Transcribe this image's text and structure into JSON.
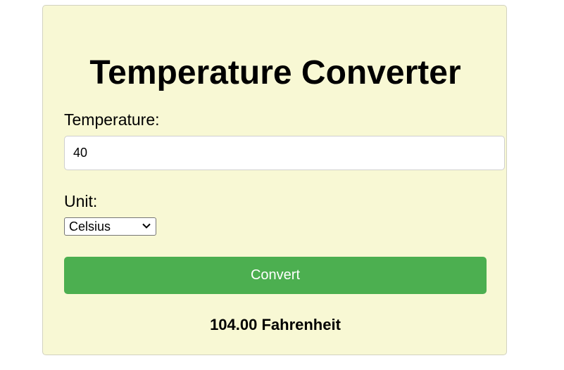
{
  "header": {
    "title": "Temperature Converter"
  },
  "form": {
    "temperature_label": "Temperature:",
    "temperature_value": "40",
    "unit_label": "Unit:",
    "unit_selected": "Celsius",
    "convert_label": "Convert"
  },
  "result": {
    "text": "104.00 Fahrenheit"
  },
  "colors": {
    "card_background": "#f8f8d4",
    "button": "#4caf50",
    "button_text": "#ffffff"
  },
  "icons": {
    "select_arrow": "chevron-down-icon"
  }
}
